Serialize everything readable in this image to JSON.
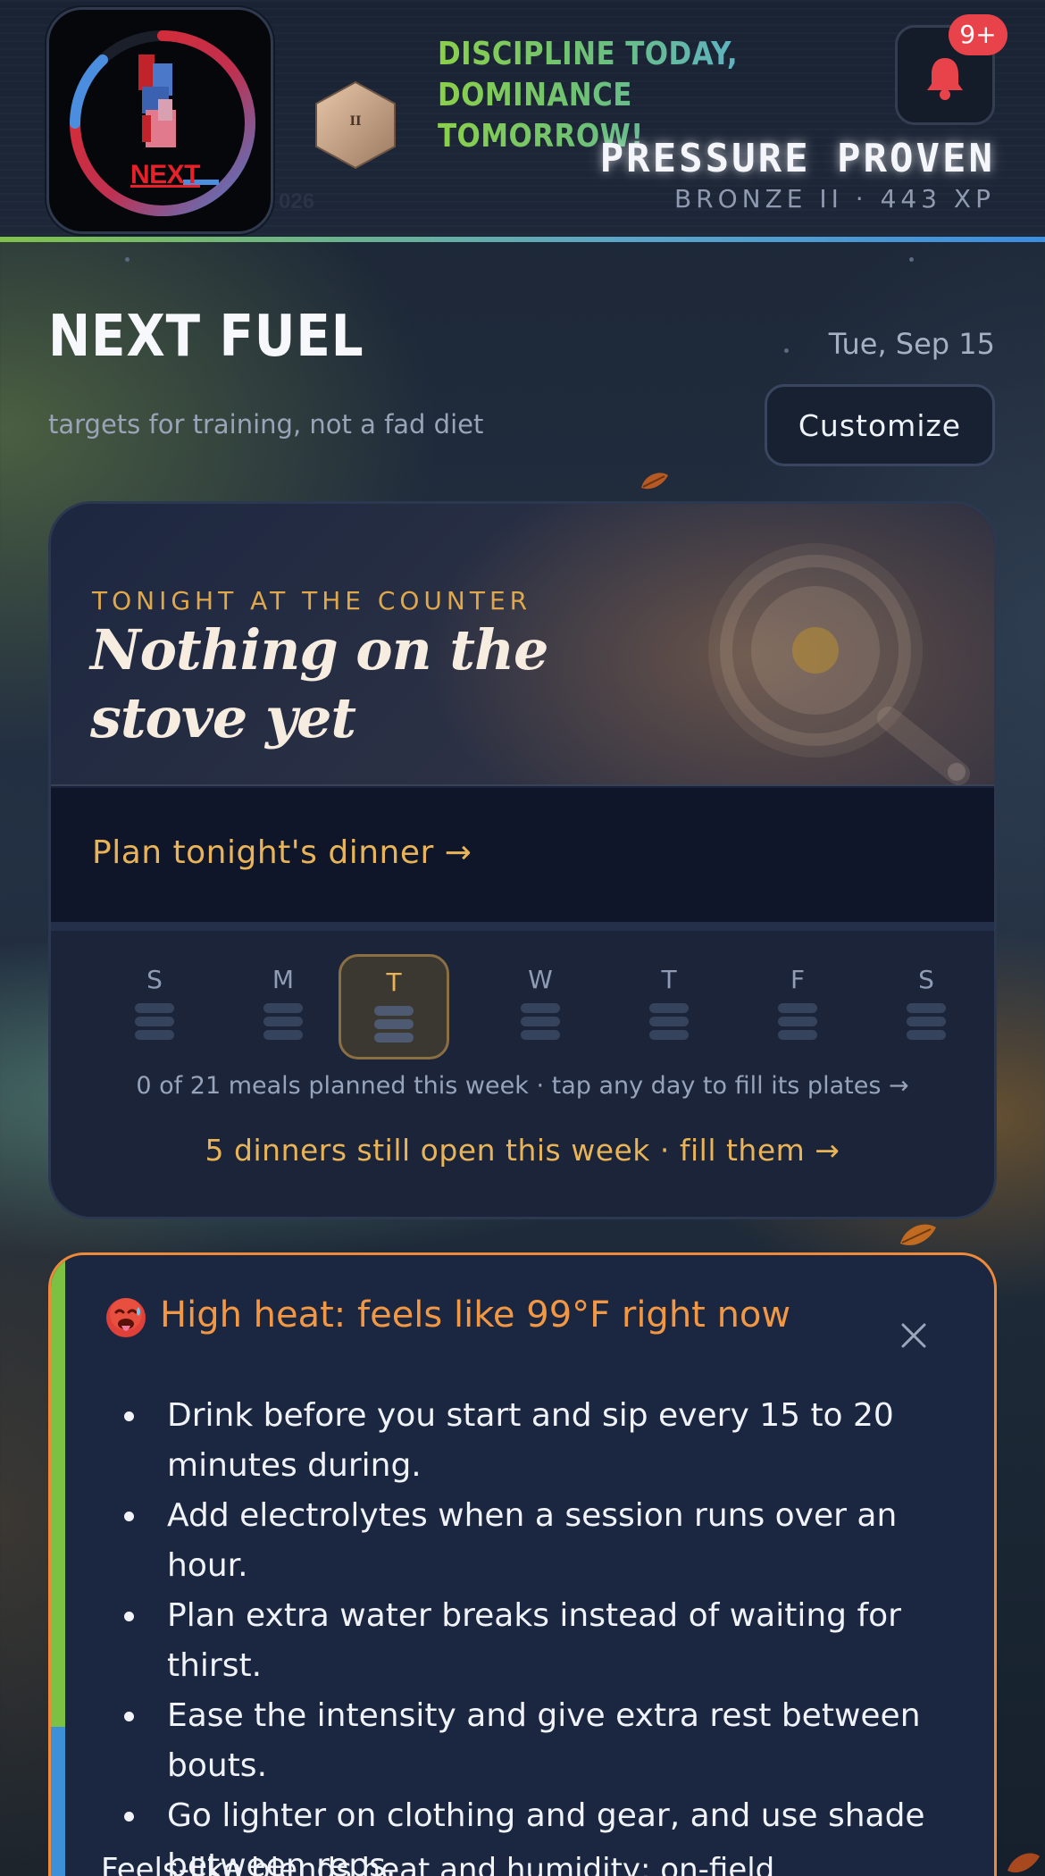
{
  "header": {
    "logo_text": "NEXT",
    "watermark": "026",
    "rank_numeral": "II",
    "slogan_line1": "DISCIPLINE TODAY,",
    "slogan_line2": "DOMINANCE TOMORROW!",
    "notifications_badge": "9+",
    "player_title": "PRESSURE PROVEN",
    "player_rank_xp": "BRONZE II · 443 XP"
  },
  "page": {
    "title": "NEXT FUEL",
    "date": "Tue, Sep 15",
    "subtitle": "targets for training, not a fad diet",
    "customize_label": "Customize"
  },
  "dinner": {
    "kicker": "TONIGHT AT THE COUNTER",
    "title": "Nothing on the stove yet",
    "plan_link": "Plan tonight's dinner →",
    "week": [
      {
        "letter": "S",
        "active": false
      },
      {
        "letter": "M",
        "active": false
      },
      {
        "letter": "T",
        "active": true
      },
      {
        "letter": "W",
        "active": false
      },
      {
        "letter": "T",
        "active": false
      },
      {
        "letter": "F",
        "active": false
      },
      {
        "letter": "S",
        "active": false
      }
    ],
    "week_note": "0 of 21 meals planned this week · tap any day to fill its plates →",
    "open_link": "5 dinners still open this week · fill them →"
  },
  "heat_alert": {
    "title": "High heat: feels like 99°F right now",
    "tips": [
      "Drink before you start and sip every 15 to 20 minutes during.",
      "Add electrolytes when a session runs over an hour.",
      "Plan extra water breaks instead of waiting for thirst.",
      "Ease the intensity and give extra rest between bouts.",
      "Go lighter on clothing and gear, and use shade between reps."
    ],
    "footer": "Feels-like blends heat and humidity; on-field"
  },
  "colors": {
    "accent_gold": "#e9b458",
    "heat_orange": "#f29743",
    "badge_red": "#e8434a"
  }
}
